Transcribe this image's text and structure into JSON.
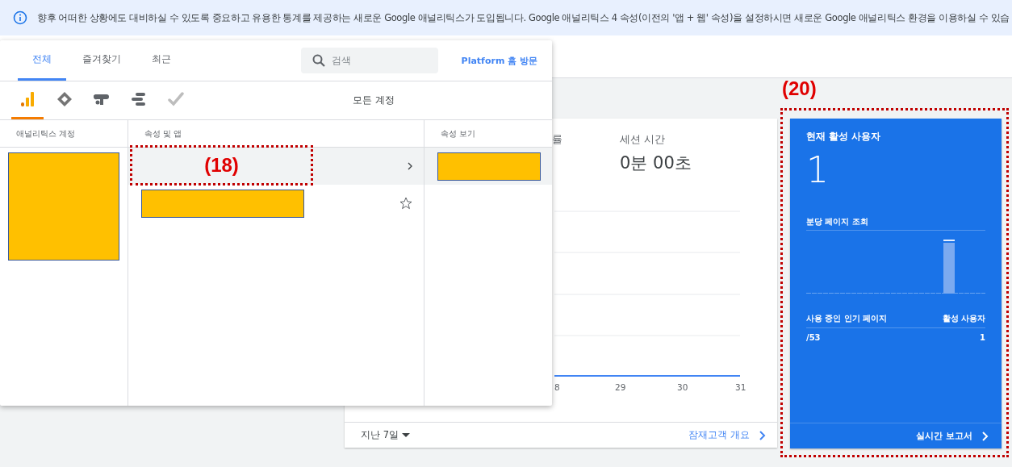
{
  "banner": {
    "text": "향후 어떠한 상황에도 대비하실 수 있도록 중요하고 유용한 통계를 제공하는 새로운 Google 애널리틱스가 도입됩니다. Google 애널리틱스 4 속성(이전의 '앱 + 웹' 속성)을 설정하시면 새로운 Google 애널리틱스 환경을 이용하실 수 있습"
  },
  "overview_card": {
    "metrics": [
      {
        "label": "률"
      },
      {
        "label": "세션 시간",
        "value": "0분 00초"
      }
    ],
    "x_labels": [
      "8",
      "29",
      "30",
      "31"
    ],
    "date_range": "지난 7일",
    "link": "잠재고객 개요"
  },
  "realtime_card": {
    "title": "현재 활성 사용자",
    "value": "1",
    "chart_title": "분당 페이지 조회",
    "table": {
      "columns": [
        "사용 중인 인기 페이지",
        "활성 사용자"
      ],
      "rows": [
        [
          "/53",
          "1"
        ]
      ]
    },
    "link": "실시간 보고서"
  },
  "account_picker": {
    "tabs": [
      {
        "label": "전체",
        "selected": true
      },
      {
        "label": "즐겨찾기",
        "selected": false
      },
      {
        "label": "최근",
        "selected": false
      }
    ],
    "search": {
      "placeholder": "검색"
    },
    "platform_link": "Platform 홈 방문",
    "products": [
      {
        "kind": "analytics",
        "selected": true
      },
      {
        "kind": "diamond",
        "selected": false
      },
      {
        "kind": "optimize",
        "selected": false
      },
      {
        "kind": "studio",
        "selected": false
      },
      {
        "kind": "check",
        "selected": false
      }
    ],
    "scope_label": "모든 계정",
    "columns": [
      {
        "heading": "애널리틱스 계정",
        "redacted": true
      },
      {
        "heading": "속성 및 앱",
        "rows": [
          {
            "selected": true,
            "kind": "expand"
          },
          {
            "selected": false,
            "kind": "favorite",
            "favorite": false,
            "redacted": true
          }
        ]
      },
      {
        "heading": "속성 보기",
        "rows": [
          {
            "selected": true,
            "kind": "plain",
            "redacted": true
          }
        ]
      }
    ]
  },
  "annotations": [
    {
      "label": "(18)"
    },
    {
      "label": "(20)"
    }
  ]
}
